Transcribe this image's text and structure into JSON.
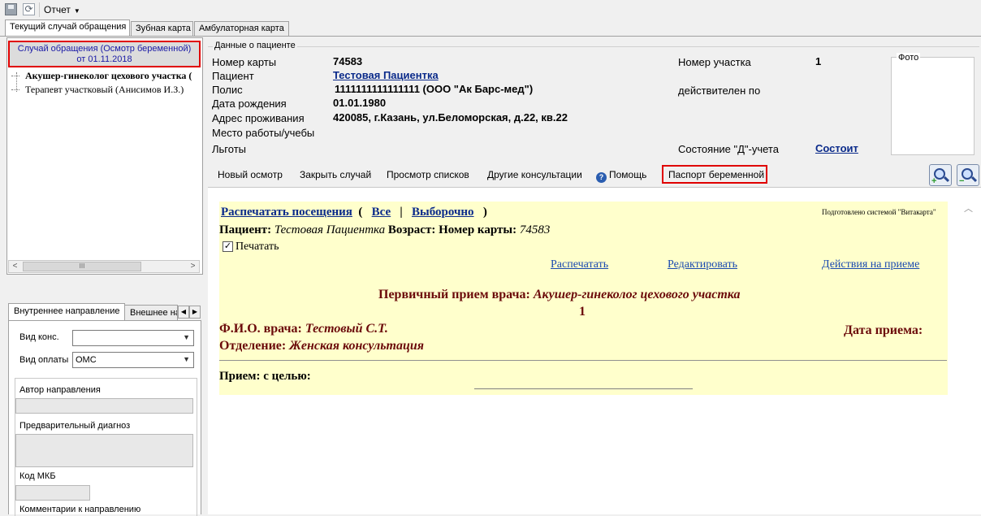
{
  "toolbar": {
    "report_menu": "Отчет"
  },
  "tabs": [
    "Текущий случай обращения",
    "Зубная карта",
    "Амбулаторная карта"
  ],
  "left": {
    "case_line1": "Случай обращения (Осмотр беременной)",
    "case_line2": "от 01.11.2018",
    "tree": [
      "Акушер-гинеколог цехового участка (",
      "Терапевт участковый (Анисимов И.З.)"
    ],
    "scroll_thumb": "III"
  },
  "direction": {
    "tab_inner": "Внутреннее направление",
    "tab_outer": "Внешнее на",
    "vid_kons_label": "Вид конс.",
    "vid_kons_value": "",
    "vid_oplaty_label": "Вид оплаты",
    "vid_oplaty_value": "ОМС",
    "author_label": "Автор направления",
    "diag_label": "Предварительный диагноз",
    "mkb_label": "Код МКБ",
    "comment_label": "Комментарии к направлению"
  },
  "patient": {
    "group_title": "Данные о пациенте",
    "card_label": "Номер карты",
    "card_value": "74583",
    "name_label": "Пациент",
    "name_value": "Тестовая Пациентка",
    "policy_label": "Полис",
    "policy_value": "1111111111111111 (ООО \"Ак Барс-мед\")",
    "dob_label": "Дата рождения",
    "dob_value": "01.01.1980",
    "address_label": "Адрес проживания",
    "address_value": "420085, г.Казань, ул.Беломорская, д.22, кв.22",
    "work_label": "Место работы/учебы",
    "benefits_label": "Льготы",
    "district_label": "Номер участка",
    "district_value": "1",
    "valid_label": "действителен по",
    "d_status_label": "Состояние \"Д\"-учета",
    "d_status_value": "Состоит",
    "photo_label": "Фото"
  },
  "actions": [
    "Новый осмотр",
    "Закрыть случай",
    "Просмотр списков",
    "Другие консультации",
    "Помощь",
    "Паспорт беременной"
  ],
  "doc": {
    "print_visits": "Распечатать посещения",
    "all": "Все",
    "selective": "Выборочно",
    "prepared_by": "Подготовлено системой \"Витакарта\"",
    "patient_label": "Пациент:",
    "patient_value": "Тестовая Пациентка",
    "age_label": "Возраст:",
    "card_label": "Номер карты:",
    "card_value": "74583",
    "print_checkbox": "Печатать",
    "print_link": "Распечатать",
    "edit_link": "Редактировать",
    "actions_link": "Действия на приеме",
    "primary_label": "Первичный прием врача:",
    "primary_value": "Акушер-гинеколог цехового участка",
    "primary_num": "1",
    "doctor_label": "Ф.И.О. врача:",
    "doctor_value": "Тестовый С.Т.",
    "date_label": "Дата приема:",
    "dept_label": "Отделение:",
    "dept_value": "Женская консультация",
    "purpose_label": "Прием: с целью:"
  }
}
